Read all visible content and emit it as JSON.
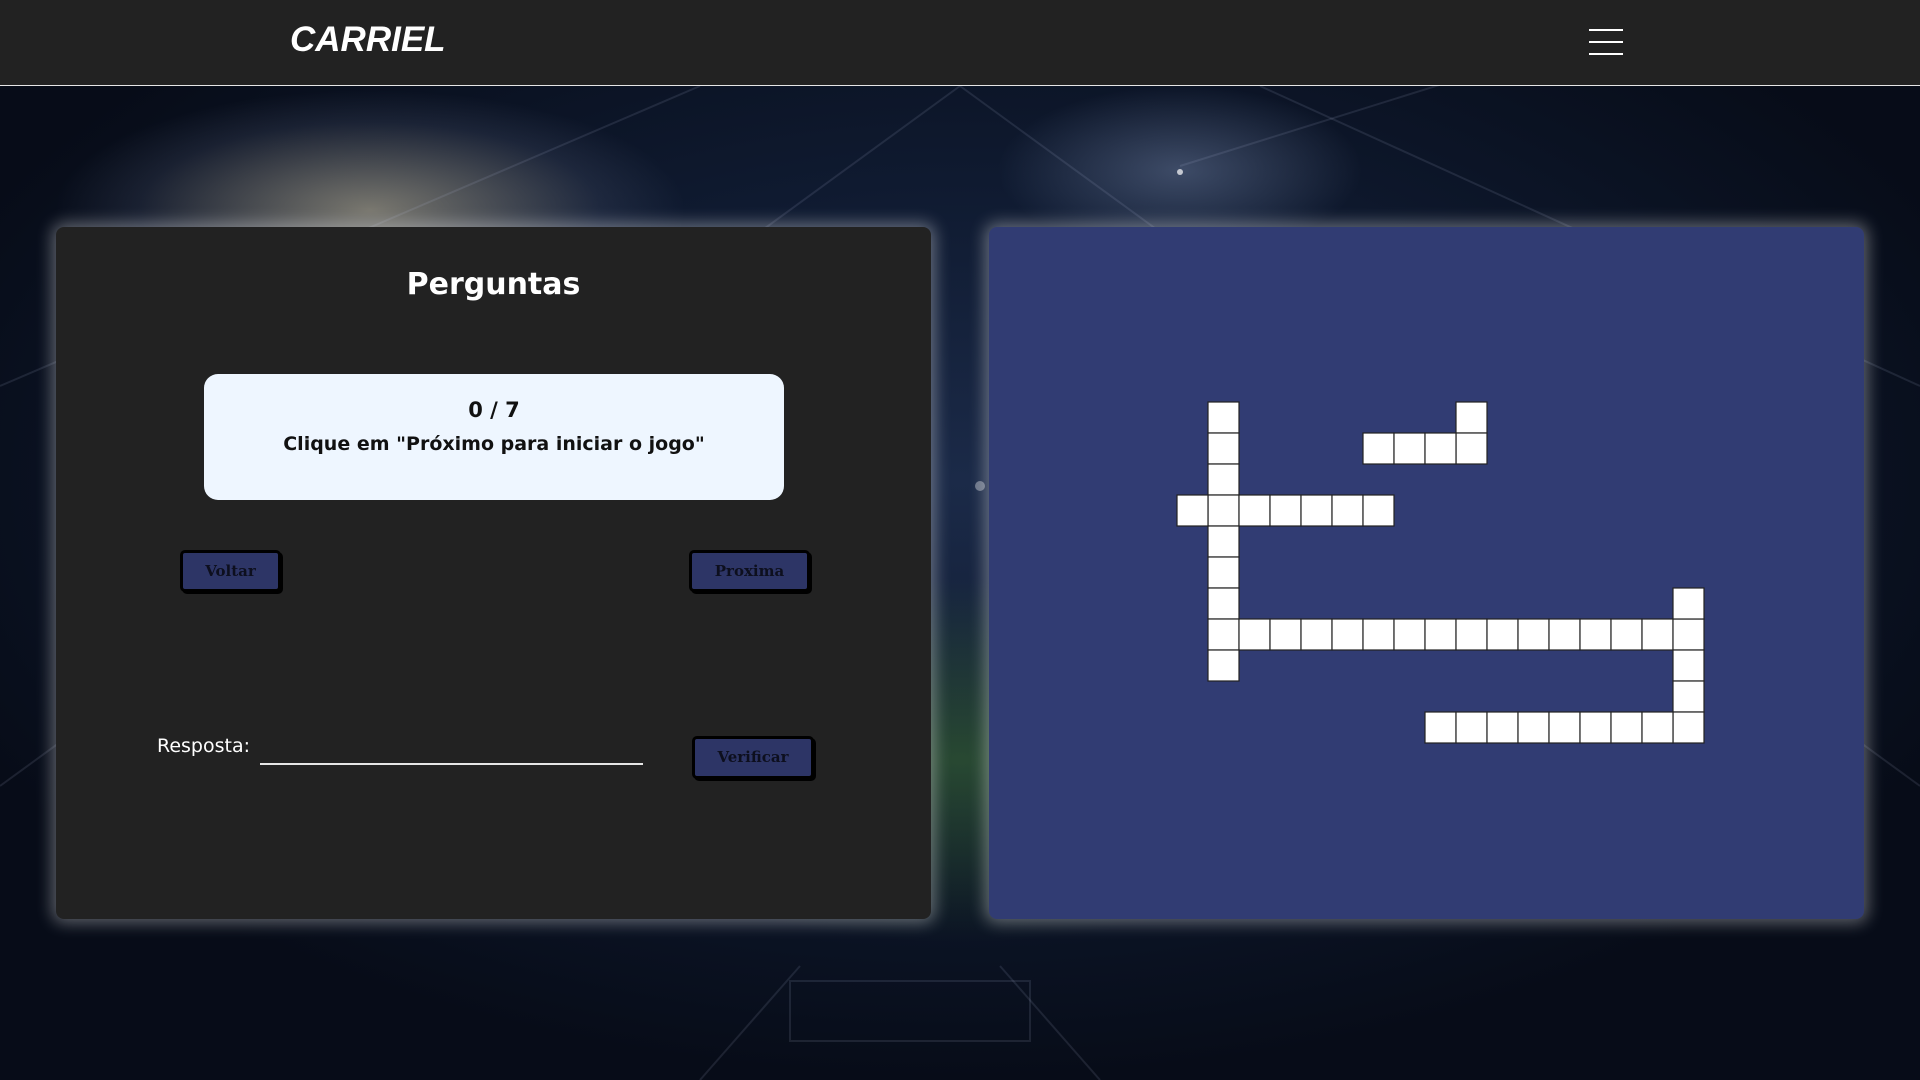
{
  "header": {
    "brand": "CARRIEL",
    "menu_icon": "hamburger-menu-icon"
  },
  "questions_panel": {
    "title": "Perguntas",
    "card": {
      "counter": "0 / 7",
      "prompt": "Clique em \"Próximo para iniciar o jogo\""
    },
    "back_label": "Voltar",
    "next_label": "Proxima",
    "answer_label": "Resposta:",
    "answer_value": "",
    "verify_label": "Verificar"
  },
  "crossword": {
    "cell_fill": "#ffffff",
    "panel_color": "#313c73",
    "words": [
      {
        "row": 0,
        "col": 1,
        "dir": "down",
        "length": 9
      },
      {
        "row": 3,
        "col": 0,
        "dir": "across",
        "length": 7
      },
      {
        "row": 0,
        "col": 9,
        "dir": "down",
        "length": 2
      },
      {
        "row": 1,
        "col": 6,
        "dir": "across",
        "length": 4
      },
      {
        "row": 7,
        "col": 1,
        "dir": "across",
        "length": 16
      },
      {
        "row": 6,
        "col": 16,
        "dir": "down",
        "length": 5
      },
      {
        "row": 10,
        "col": 8,
        "dir": "across",
        "length": 9
      }
    ]
  }
}
